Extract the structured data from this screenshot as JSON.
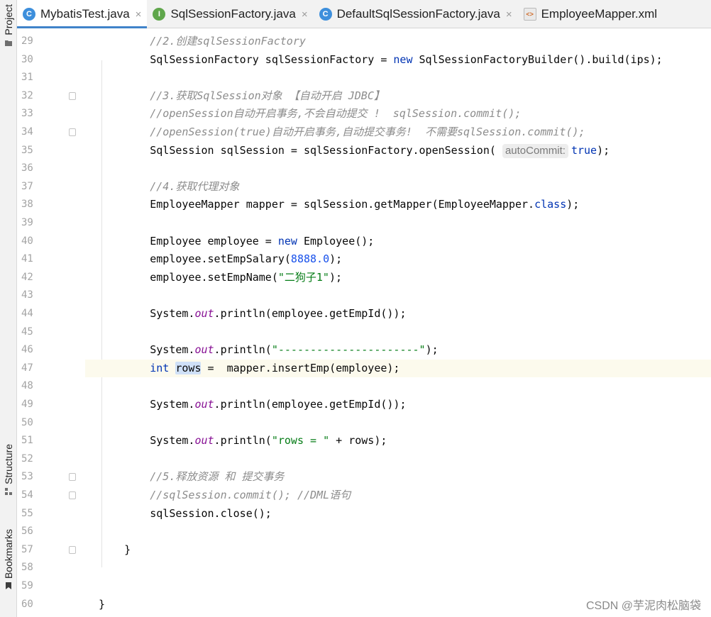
{
  "tool_strip": {
    "project": "Project",
    "structure": "Structure",
    "bookmarks": "Bookmarks"
  },
  "tabs": [
    {
      "label": "MybatisTest.java",
      "icon": "C",
      "kind": "class",
      "active": true
    },
    {
      "label": "SqlSessionFactory.java",
      "icon": "I",
      "kind": "iface",
      "active": false
    },
    {
      "label": "DefaultSqlSessionFactory.java",
      "icon": "C",
      "kind": "class",
      "active": false
    },
    {
      "label": "EmployeeMapper.xml",
      "icon": "<>",
      "kind": "xml",
      "active": false
    }
  ],
  "tab_close_glyph": "×",
  "current_line": 47,
  "fold_markers": [
    32,
    34,
    53,
    54,
    57
  ],
  "lines": [
    {
      "n": "29",
      "indent": 8,
      "segs": [
        {
          "t": "cm",
          "v": "//2.创建sqlSessionFactory"
        }
      ]
    },
    {
      "n": "30",
      "indent": 8,
      "segs": [
        {
          "t": "",
          "v": "SqlSessionFactory sqlSessionFactory = "
        },
        {
          "t": "kw",
          "v": "new"
        },
        {
          "t": "",
          "v": " SqlSessionFactoryBuilder().build(ips);"
        }
      ]
    },
    {
      "n": "31",
      "indent": 0,
      "segs": []
    },
    {
      "n": "32",
      "indent": 8,
      "segs": [
        {
          "t": "cm",
          "v": "//3.获取SqlSession对象 【自动开启 JDBC】"
        }
      ]
    },
    {
      "n": "33",
      "indent": 8,
      "segs": [
        {
          "t": "cm",
          "v": "//openSession自动开启事务,不会自动提交 !  sqlSession.commit();"
        }
      ]
    },
    {
      "n": "34",
      "indent": 8,
      "segs": [
        {
          "t": "cm",
          "v": "//openSession(true)自动开启事务,自动提交事务!  不需要sqlSession.commit();"
        }
      ]
    },
    {
      "n": "35",
      "indent": 8,
      "segs": [
        {
          "t": "",
          "v": "SqlSession sqlSession = sqlSessionFactory.openSession( "
        },
        {
          "t": "hint",
          "v": "autoCommit:"
        },
        {
          "t": "kw",
          "v": "true"
        },
        {
          "t": "",
          "v": ");"
        }
      ]
    },
    {
      "n": "36",
      "indent": 0,
      "segs": []
    },
    {
      "n": "37",
      "indent": 8,
      "segs": [
        {
          "t": "cm",
          "v": "//4.获取代理对象"
        }
      ]
    },
    {
      "n": "38",
      "indent": 8,
      "segs": [
        {
          "t": "",
          "v": "EmployeeMapper mapper = sqlSession.getMapper(EmployeeMapper."
        },
        {
          "t": "kw",
          "v": "class"
        },
        {
          "t": "",
          "v": ");"
        }
      ]
    },
    {
      "n": "39",
      "indent": 0,
      "segs": []
    },
    {
      "n": "40",
      "indent": 8,
      "segs": [
        {
          "t": "",
          "v": "Employee employee = "
        },
        {
          "t": "kw",
          "v": "new"
        },
        {
          "t": "",
          "v": " Employee();"
        }
      ]
    },
    {
      "n": "41",
      "indent": 8,
      "segs": [
        {
          "t": "",
          "v": "employee.setEmpSalary("
        },
        {
          "t": "num",
          "v": "8888.0"
        },
        {
          "t": "",
          "v": ");"
        }
      ]
    },
    {
      "n": "42",
      "indent": 8,
      "segs": [
        {
          "t": "",
          "v": "employee.setEmpName("
        },
        {
          "t": "str",
          "v": "\"二狗子1\""
        },
        {
          "t": "",
          "v": ");"
        }
      ]
    },
    {
      "n": "43",
      "indent": 0,
      "segs": []
    },
    {
      "n": "44",
      "indent": 8,
      "segs": [
        {
          "t": "",
          "v": "System."
        },
        {
          "t": "static",
          "v": "out"
        },
        {
          "t": "",
          "v": ".println(employee.getEmpId());"
        }
      ]
    },
    {
      "n": "45",
      "indent": 0,
      "segs": []
    },
    {
      "n": "46",
      "indent": 8,
      "segs": [
        {
          "t": "",
          "v": "System."
        },
        {
          "t": "static",
          "v": "out"
        },
        {
          "t": "",
          "v": ".println("
        },
        {
          "t": "str",
          "v": "\"----------------------\""
        },
        {
          "t": "",
          "v": ");"
        }
      ]
    },
    {
      "n": "47",
      "indent": 8,
      "segs": [
        {
          "t": "kw",
          "v": "int"
        },
        {
          "t": "",
          "v": " "
        },
        {
          "t": "hl",
          "v": "rows"
        },
        {
          "t": "",
          "v": " =  mapper.insertEmp(employee);"
        }
      ]
    },
    {
      "n": "48",
      "indent": 0,
      "segs": []
    },
    {
      "n": "49",
      "indent": 8,
      "segs": [
        {
          "t": "",
          "v": "System."
        },
        {
          "t": "static",
          "v": "out"
        },
        {
          "t": "",
          "v": ".println(employee.getEmpId());"
        }
      ]
    },
    {
      "n": "50",
      "indent": 0,
      "segs": []
    },
    {
      "n": "51",
      "indent": 8,
      "segs": [
        {
          "t": "",
          "v": "System."
        },
        {
          "t": "static",
          "v": "out"
        },
        {
          "t": "",
          "v": ".println("
        },
        {
          "t": "str",
          "v": "\"rows = \""
        },
        {
          "t": "",
          "v": " + rows);"
        }
      ]
    },
    {
      "n": "52",
      "indent": 0,
      "segs": []
    },
    {
      "n": "53",
      "indent": 8,
      "segs": [
        {
          "t": "cm",
          "v": "//5.释放资源 和 提交事务"
        }
      ]
    },
    {
      "n": "54",
      "indent": 8,
      "segs": [
        {
          "t": "cm",
          "v": "//sqlSession.commit(); //DML语句"
        }
      ]
    },
    {
      "n": "55",
      "indent": 8,
      "segs": [
        {
          "t": "",
          "v": "sqlSession.close();"
        }
      ]
    },
    {
      "n": "56",
      "indent": 0,
      "segs": []
    },
    {
      "n": "57",
      "indent": 4,
      "segs": [
        {
          "t": "",
          "v": "}"
        }
      ]
    },
    {
      "n": "58",
      "indent": 0,
      "segs": []
    },
    {
      "n": "59",
      "indent": 0,
      "segs": []
    },
    {
      "n": "60",
      "indent": 0,
      "segs": [
        {
          "t": "",
          "v": "}"
        }
      ]
    }
  ],
  "watermark": "CSDN @芋泥肉松脑袋"
}
